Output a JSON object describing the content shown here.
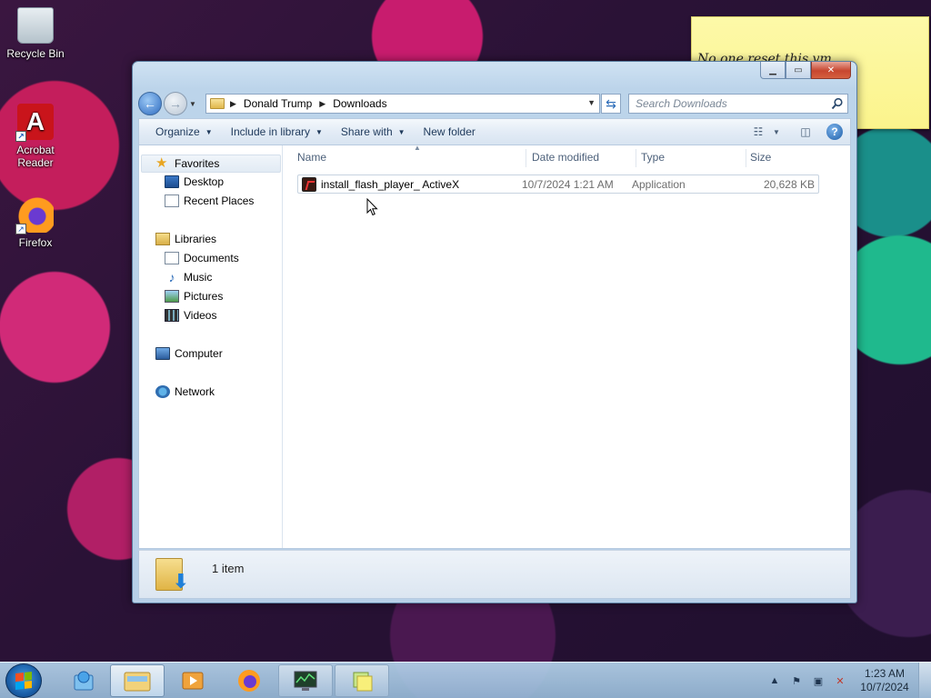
{
  "desktop": {
    "icons": [
      {
        "label": "Recycle Bin",
        "icon": "recycle-bin-icon"
      },
      {
        "label": "Acrobat Reader",
        "icon": "acrobat-icon"
      },
      {
        "label": "Firefox",
        "icon": "firefox-icon"
      }
    ],
    "sticky_note": {
      "text": "No one reset this vm"
    }
  },
  "window": {
    "caption_buttons": {
      "minimize": "minimize",
      "maximize": "maximize",
      "close": "close"
    },
    "address": {
      "crumbs": [
        "Donald Trump",
        "Downloads"
      ]
    },
    "search": {
      "placeholder": "Search Downloads"
    },
    "toolbar": {
      "organize": "Organize",
      "include_in_library": "Include in library",
      "share_with": "Share with",
      "new_folder": "New folder"
    },
    "nav_pane": {
      "favorites": "Favorites",
      "favorites_items": [
        "Desktop",
        "Recent Places"
      ],
      "libraries": "Libraries",
      "library_items": [
        "Documents",
        "Music",
        "Pictures",
        "Videos"
      ],
      "computer": "Computer",
      "network": "Network"
    },
    "columns": {
      "name": "Name",
      "date_modified": "Date modified",
      "type": "Type",
      "size": "Size"
    },
    "files": [
      {
        "name": "install_flash_player_ ActiveX",
        "date_modified": "10/7/2024 1:21 AM",
        "type": "Application",
        "size": "20,628 KB"
      }
    ],
    "details": {
      "item_count": "1 item"
    }
  },
  "taskbar": {
    "clock": {
      "time": "1:23 AM",
      "date": "10/7/2024"
    },
    "pinned": [
      "start-button",
      "explorer-task",
      "file-explorer-task",
      "media-player-task",
      "firefox-task",
      "task-manager-task",
      "sticky-notes-task"
    ]
  }
}
